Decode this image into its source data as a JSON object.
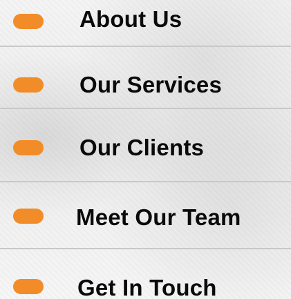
{
  "menu": {
    "items": [
      {
        "label": "About Us"
      },
      {
        "label": "Our Services"
      },
      {
        "label": "Our Clients"
      },
      {
        "label": "Meet Our Team"
      },
      {
        "label": "Get In Touch"
      }
    ]
  },
  "colors": {
    "accent": "#f28c28",
    "text": "#0a0a0a",
    "divider": "#c8c8c8"
  }
}
